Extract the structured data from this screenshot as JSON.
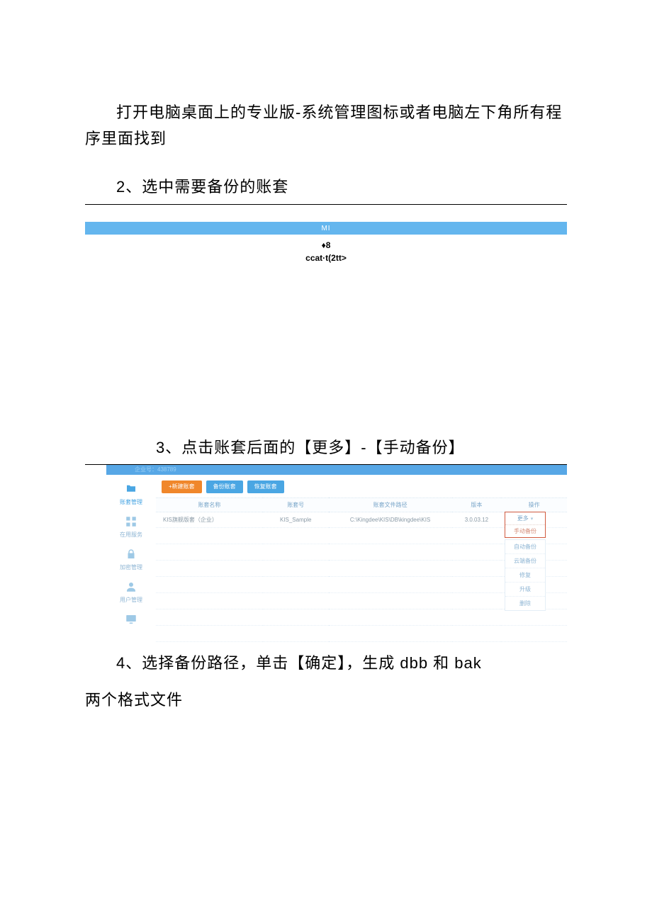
{
  "doc": {
    "intro": "打开电脑桌面上的专业版-系统管理图标或者电脑左下角所有程序里面找到",
    "step2": "2、选中需要备份的账套",
    "step3": "3、点击账套后面的【更多】-【手动备份】",
    "step4_line1": "4、选择备份路径，单击【确定】，生成 dbb 和 bak",
    "step4_line2": "两个格式文件"
  },
  "fig1": {
    "bar_text": "MI",
    "line1": "♦8",
    "line2": "ccat·t(2tt>"
  },
  "fig2": {
    "topbar": "企业号：438789",
    "sidebar": [
      {
        "name": "account-mgmt",
        "label": "账套管理",
        "active": true
      },
      {
        "name": "app-service",
        "label": "在用服务",
        "active": false
      },
      {
        "name": "encrypt-mgmt",
        "label": "加密管理",
        "active": false
      },
      {
        "name": "user-mgmt",
        "label": "用户管理",
        "active": false
      },
      {
        "name": "misc",
        "label": "",
        "active": false
      }
    ],
    "buttons": {
      "new": "+新建账套",
      "backup": "备份账套",
      "restore": "恢复账套"
    },
    "columns": {
      "name": "账套名称",
      "code": "账套号",
      "path": "账套文件路径",
      "ver": "版本",
      "op": "操作"
    },
    "row": {
      "name": "KIS旗舰版套（企业）",
      "code": "KIS_Sample",
      "path": "C:\\Kingdee\\KIS\\DB\\kingdee\\KIS",
      "ver": "3.0.03.12"
    },
    "menu": {
      "more": "更多",
      "manual_backup": "手动备份",
      "items": [
        "自动备份",
        "云端备份",
        "修复",
        "升级",
        "删除"
      ]
    }
  }
}
